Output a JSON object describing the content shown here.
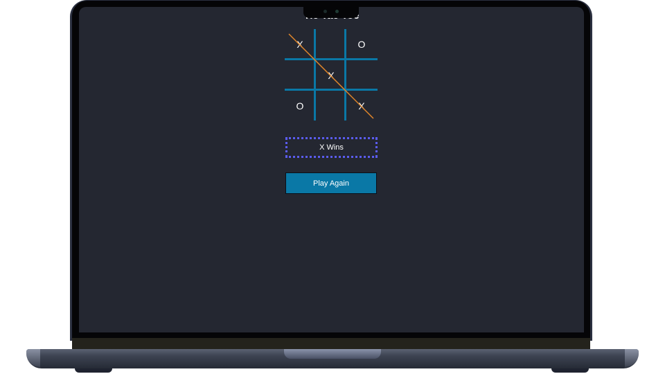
{
  "app": {
    "title": "Tic Tac Toe"
  },
  "board": {
    "cells": [
      "X",
      "",
      "O",
      "",
      "X",
      "",
      "O",
      "",
      "X"
    ],
    "winning_line": "diagonal top-left to bottom-right"
  },
  "status": {
    "text": "X Wins"
  },
  "actions": {
    "play_again_label": "Play Again"
  },
  "colors": {
    "screen_bg": "#242731",
    "grid": "#0a78a6",
    "win_line": "#e0862a",
    "status_border": "#5b5cf0",
    "button_bg": "#0a78a6",
    "text": "#ffffff"
  },
  "icons": {
    "camera": "camera-icon"
  }
}
